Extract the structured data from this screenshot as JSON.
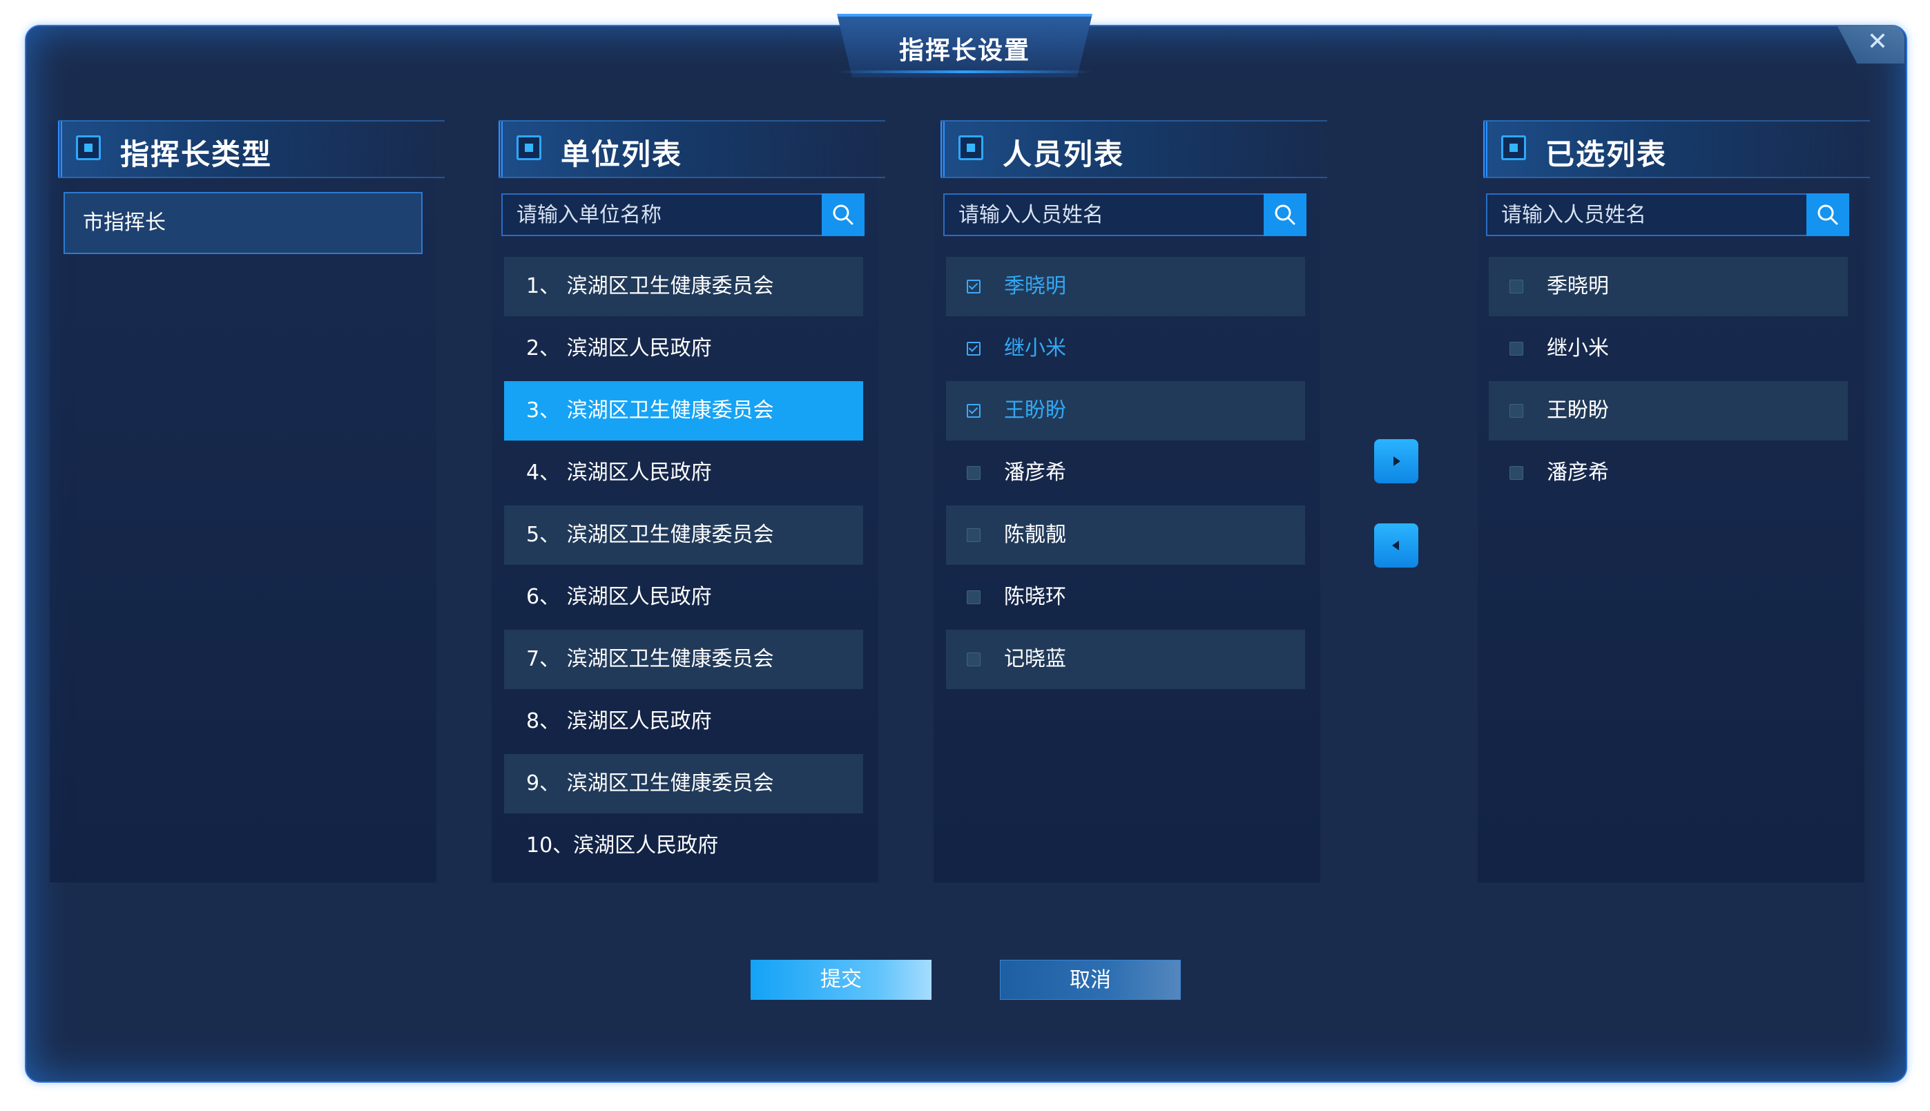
{
  "dialog": {
    "title": "指挥长设置",
    "close_label": "✕"
  },
  "type_section": {
    "title": "指挥长类型",
    "items": [
      "市指挥长"
    ]
  },
  "org_section": {
    "title": "单位列表",
    "search_placeholder": "请输入单位名称",
    "items": [
      {
        "label": "1、 滨湖区卫生健康委员会",
        "selected": false
      },
      {
        "label": "2、 滨湖区人民政府",
        "selected": false
      },
      {
        "label": "3、 滨湖区卫生健康委员会",
        "selected": true
      },
      {
        "label": "4、 滨湖区人民政府",
        "selected": false
      },
      {
        "label": "5、 滨湖区卫生健康委员会",
        "selected": false
      },
      {
        "label": "6、 滨湖区人民政府",
        "selected": false
      },
      {
        "label": "7、 滨湖区卫生健康委员会",
        "selected": false
      },
      {
        "label": "8、 滨湖区人民政府",
        "selected": false
      },
      {
        "label": "9、 滨湖区卫生健康委员会",
        "selected": false
      },
      {
        "label": "10、滨湖区人民政府",
        "selected": false
      }
    ]
  },
  "person_section": {
    "title": "人员列表",
    "search_placeholder": "请输入人员姓名",
    "items": [
      {
        "name": "季晓明",
        "checked": true
      },
      {
        "name": "继小米",
        "checked": true
      },
      {
        "name": "王盼盼",
        "checked": true
      },
      {
        "name": "潘彦希",
        "checked": false
      },
      {
        "name": "陈靓靓",
        "checked": false
      },
      {
        "name": "陈晓环",
        "checked": false
      },
      {
        "name": "记晓蓝",
        "checked": false
      }
    ]
  },
  "selected_section": {
    "title": "已选列表",
    "search_placeholder": "请输入人员姓名",
    "items": [
      {
        "name": "季晓明",
        "checked": false
      },
      {
        "name": "继小米",
        "checked": false
      },
      {
        "name": "王盼盼",
        "checked": false
      },
      {
        "name": "潘彦希",
        "checked": false
      }
    ]
  },
  "actions": {
    "submit_label": "提交",
    "cancel_label": "取消"
  },
  "icons": {
    "search": "search-icon",
    "move_right": "caret-right-icon",
    "move_left": "caret-left-icon",
    "section": "section-marker-icon",
    "close": "close-icon"
  },
  "colors": {
    "accent": "#16a3f5",
    "background": "#1a2c4e",
    "checked_text": "#32a8f4"
  }
}
